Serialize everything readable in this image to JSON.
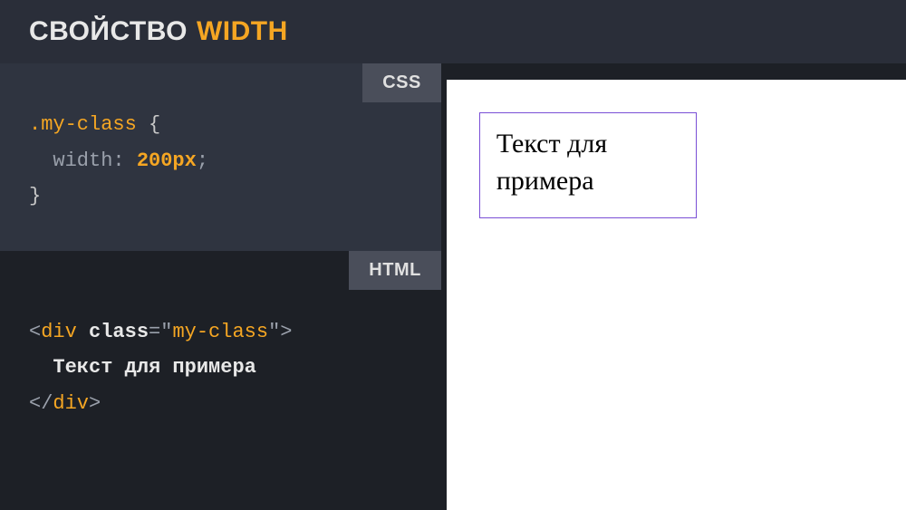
{
  "header": {
    "title": "СВОЙСТВО",
    "keyword": "WIDTH"
  },
  "tabs": {
    "css": "CSS",
    "html": "HTML"
  },
  "css_code": {
    "selector": ".my-class",
    "brace_open": "{",
    "property": "width",
    "colon": ":",
    "value": "200px",
    "semicolon": ";",
    "brace_close": "}"
  },
  "html_code": {
    "open_lt": "<",
    "tag": "div",
    "attr_name": "class",
    "eq": "=",
    "quote": "\"",
    "attr_value": "my-class",
    "open_gt": ">",
    "text_content": "Текст для примера",
    "close_lt": "</",
    "close_gt": ">"
  },
  "preview": {
    "text": "Текст для примера"
  }
}
